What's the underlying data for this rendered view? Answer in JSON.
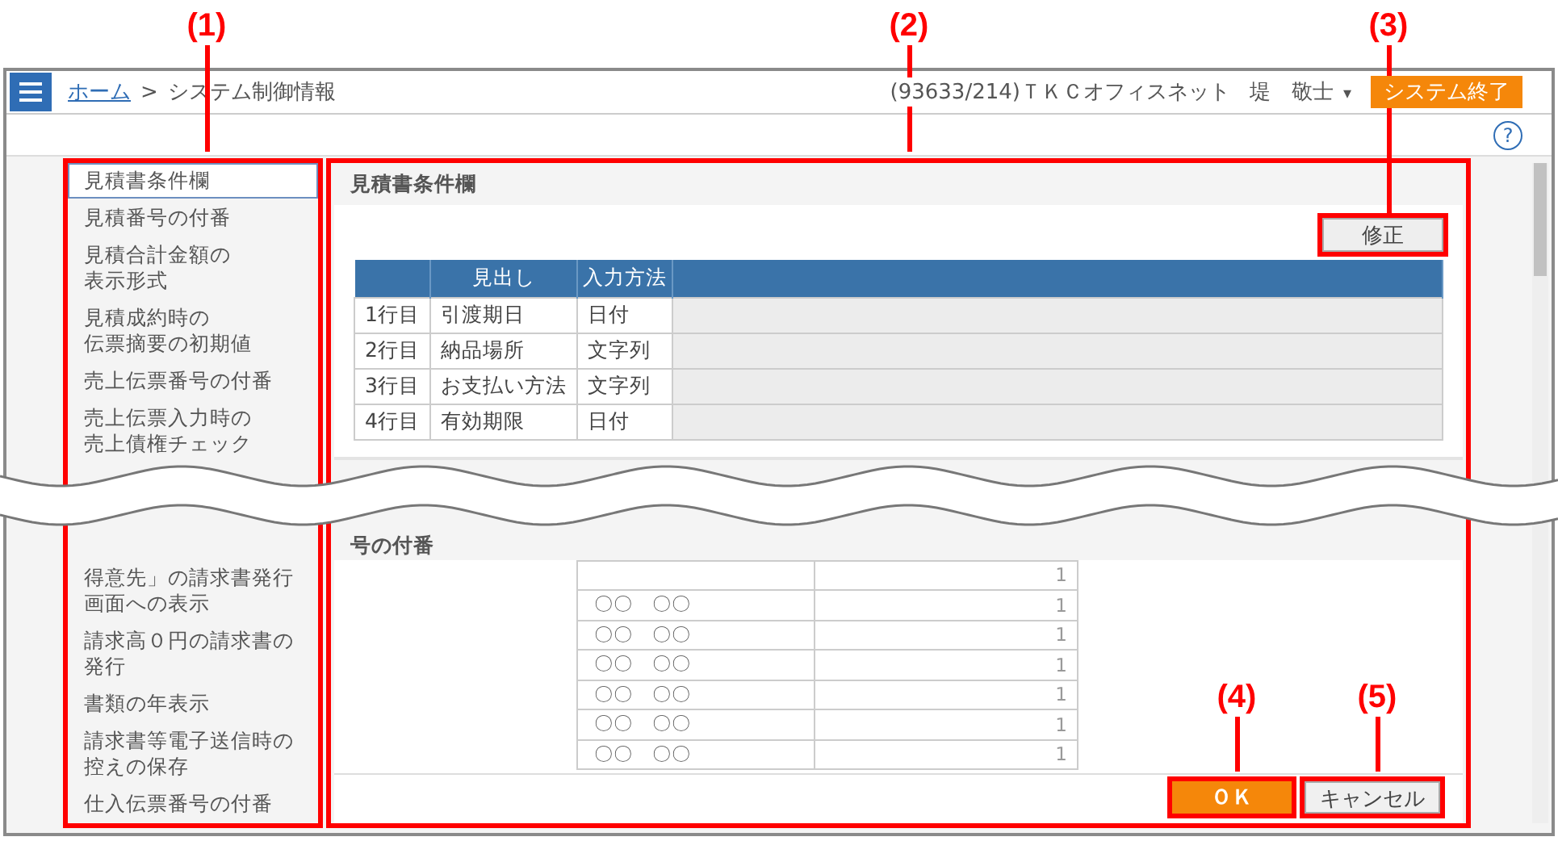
{
  "callouts": [
    "(1)",
    "(2)",
    "(3)",
    "(4)",
    "(5)"
  ],
  "header": {
    "breadcrumb": [
      {
        "label": "ホーム",
        "link": true
      },
      {
        "label": ">",
        "link": false
      },
      {
        "label": "システム制御情報",
        "link": false
      }
    ],
    "office": "(93633/214)ＴＫＣオフィスネット",
    "user": "堤　敬士",
    "user_caret": "▾",
    "exit_button": "システム終了",
    "help": "?"
  },
  "sidebar": {
    "items": [
      {
        "label": "見積書条件欄",
        "selected": true
      },
      {
        "label": "見積番号の付番",
        "selected": false
      },
      {
        "lines": [
          "見積合計金額の",
          "表示形式"
        ],
        "selected": false
      },
      {
        "lines": [
          "見積成約時の",
          "伝票摘要の初期値"
        ],
        "selected": false
      },
      {
        "label": "売上伝票番号の付番",
        "selected": false
      },
      {
        "lines": [
          "売上伝票入力時の",
          "売上債権チェック"
        ],
        "selected": false
      }
    ],
    "items_after_break": [
      {
        "lines": [
          "得意先」の請求書発行",
          "画面への表示"
        ],
        "selected": false
      },
      {
        "lines": [
          "請求高０円の請求書の",
          "発行"
        ],
        "selected": false
      },
      {
        "label": "書類の年表示",
        "selected": false
      },
      {
        "lines": [
          "請求書等電子送信時の",
          "控えの保存"
        ],
        "selected": false
      },
      {
        "label": "仕入伝票番号の付番",
        "selected": false
      }
    ]
  },
  "section": {
    "title": "見積書条件欄",
    "edit_button": "修正",
    "columns": [
      "見出し",
      "入力方法"
    ],
    "rows": [
      {
        "line": "1行目",
        "heading": "引渡期日",
        "method": "日付"
      },
      {
        "line": "2行目",
        "heading": "納品場所",
        "method": "文字列"
      },
      {
        "line": "3行目",
        "heading": "お支払い方法",
        "method": "文字列"
      },
      {
        "line": "4行目",
        "heading": "有効期限",
        "method": "日付"
      }
    ]
  },
  "section_after_break": {
    "title": "号の付番",
    "rows": [
      {
        "count": "1"
      },
      {
        "name": "〇〇　〇〇",
        "count": "1"
      },
      {
        "name": "〇〇　〇〇",
        "count": "1"
      },
      {
        "name": "〇〇　〇〇",
        "count": "1"
      },
      {
        "name": "〇〇　〇〇",
        "count": "1"
      },
      {
        "name": "〇〇　〇〇",
        "count": "1"
      },
      {
        "name": "〇〇　〇〇",
        "count": "1"
      }
    ]
  },
  "buttons": {
    "ok": "ＯＫ",
    "cancel": "キャンセル"
  }
}
